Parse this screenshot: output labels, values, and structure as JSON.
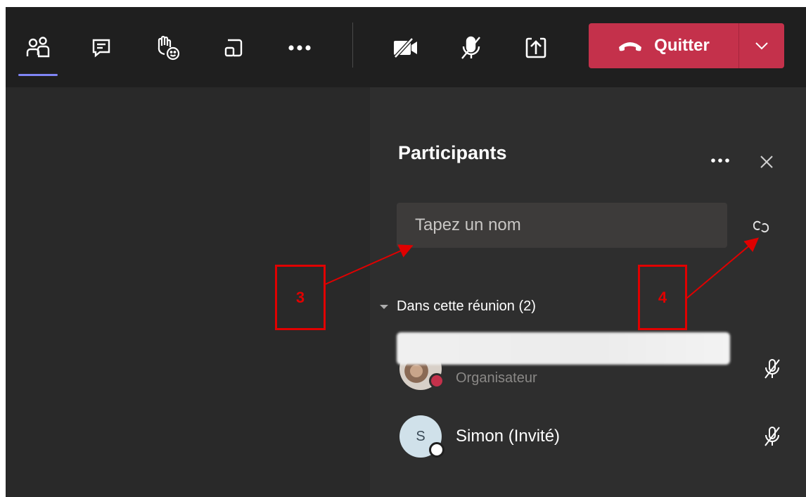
{
  "toolbar": {
    "buttons": [
      {
        "name": "participants-icon"
      },
      {
        "name": "chat-icon"
      },
      {
        "name": "reactions-icon"
      },
      {
        "name": "rooms-icon"
      },
      {
        "name": "more-actions-icon"
      },
      {
        "name": "camera-off-icon"
      },
      {
        "name": "mic-off-icon"
      },
      {
        "name": "share-icon"
      }
    ],
    "leave": {
      "label": "Quitter",
      "icon": "phone-hangup-icon",
      "menu_icon": "chevron-down-icon"
    },
    "active_color": "#7f85f5",
    "leave_color": "#c4314b"
  },
  "panel": {
    "title": "Participants",
    "more_icon": "more-options-icon",
    "close_icon": "close-icon",
    "search": {
      "placeholder": "Tapez un nom",
      "value": ""
    },
    "share_link_icon": "link-icon",
    "section": {
      "label": "Dans cette réunion (2)"
    },
    "participants": [
      {
        "name": "",
        "role": "Organisateur",
        "presence": "busy",
        "mic": "muted"
      },
      {
        "name": "Simon (Invité)",
        "initial": "S",
        "role": "",
        "presence": "offline",
        "mic": "muted"
      }
    ]
  },
  "annotations": [
    {
      "label": "3"
    },
    {
      "label": "4"
    }
  ]
}
